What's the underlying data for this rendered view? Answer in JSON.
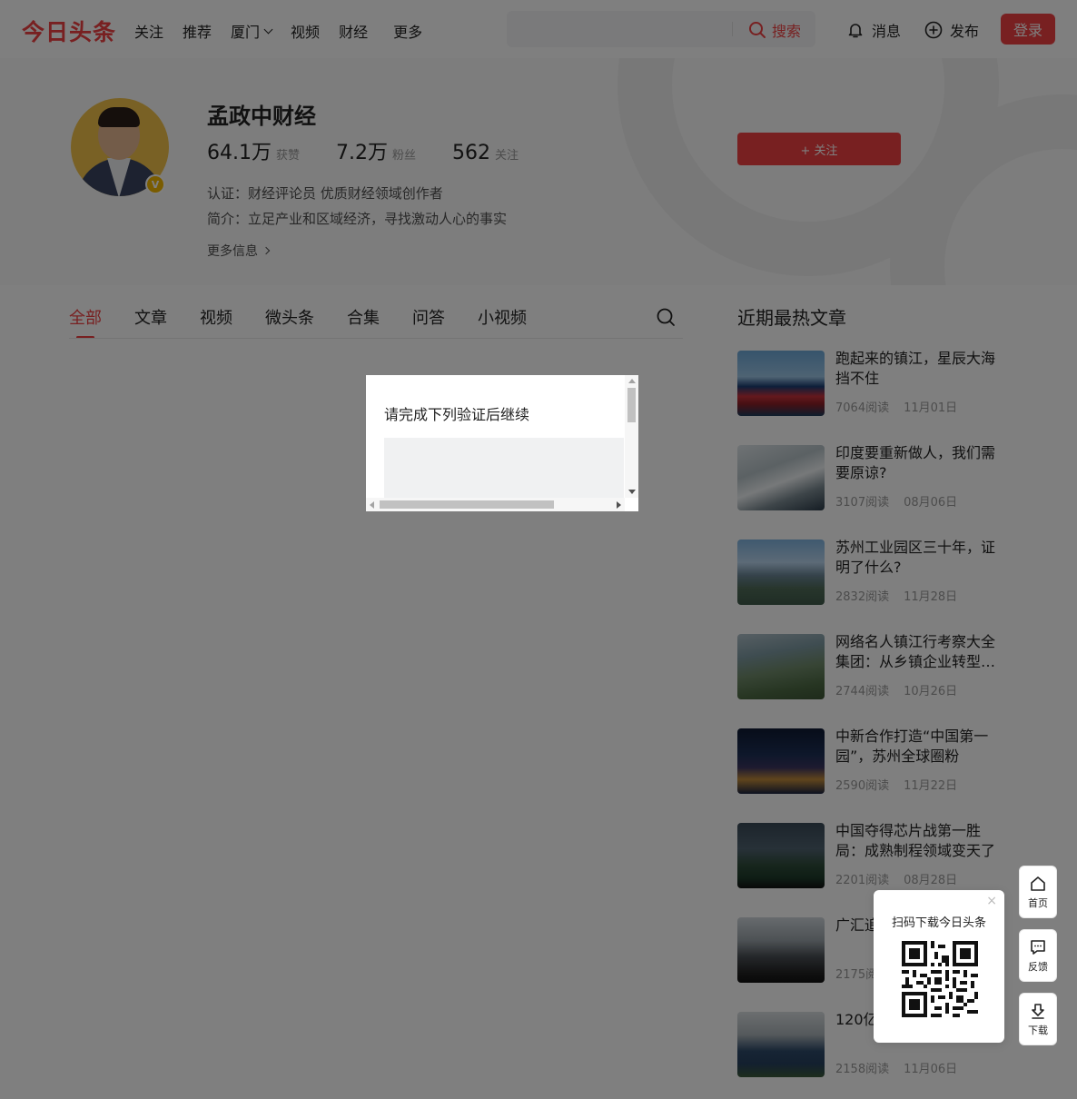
{
  "header": {
    "logo": "今日头条",
    "nav": [
      "关注",
      "推荐",
      "厦门",
      "视频",
      "财经",
      "更多"
    ],
    "search_button": "搜索",
    "messages": "消息",
    "publish": "发布",
    "login": "登录"
  },
  "profile": {
    "name": "孟政中财经",
    "stats": [
      {
        "num": "64.1万",
        "label": "获赞"
      },
      {
        "num": "7.2万",
        "label": "粉丝"
      },
      {
        "num": "562",
        "label": "关注"
      }
    ],
    "certification": "认证：财经评论员 优质财经领域创作者",
    "bio": "简介：立足产业和区域经济，寻找激动人心的事实",
    "more_info": "更多信息",
    "follow_button": "+ 关注",
    "badge": "V"
  },
  "tabs": [
    "全部",
    "文章",
    "视频",
    "微头条",
    "合集",
    "问答",
    "小视频"
  ],
  "sidebar": {
    "title": "近期最热文章",
    "articles": [
      {
        "title": "跑起来的镇江，星辰大海挡不住",
        "reads": "7064阅读",
        "date": "11月01日"
      },
      {
        "title": "印度要重新做人，我们需要原谅?",
        "reads": "3107阅读",
        "date": "08月06日"
      },
      {
        "title": "苏州工业园区三十年，证明了什么?",
        "reads": "2832阅读",
        "date": "11月28日"
      },
      {
        "title": "网络名人镇江行考察大全集团：从乡镇企业转型…",
        "reads": "2744阅读",
        "date": "10月26日"
      },
      {
        "title": "中新合作打造“中国第一园”，苏州全球圈粉",
        "reads": "2590阅读",
        "date": "11月22日"
      },
      {
        "title": "中国夺得芯片战第一胜局：成熟制程领域变天了",
        "reads": "2201阅读",
        "date": "08月28日"
      },
      {
        "title": "广汇追后稻草",
        "reads": "2175阅读",
        "date": ""
      },
      {
        "title": "120亿州开启B计划",
        "reads": "2158阅读",
        "date": "11月06日"
      }
    ]
  },
  "modal": {
    "title": "请完成下列验证后继续"
  },
  "qr": {
    "text": "扫码下载今日头条",
    "close": "×"
  },
  "side_tools": [
    {
      "label": "首页"
    },
    {
      "label": "反馈"
    },
    {
      "label": "下载"
    }
  ]
}
